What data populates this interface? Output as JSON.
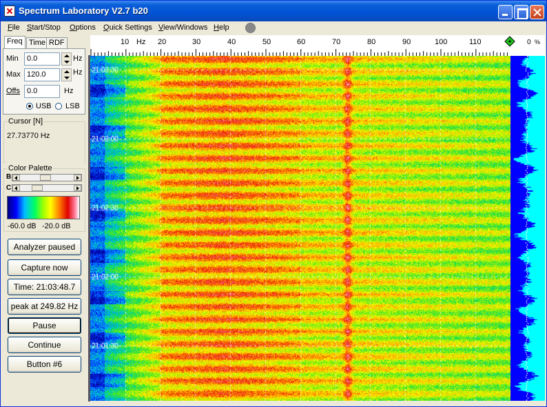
{
  "window": {
    "title": "Spectrum Laboratory V2.7 b20"
  },
  "menu": [
    {
      "label": "File",
      "u": "F",
      "rest": "ile"
    },
    {
      "label": "Start/Stop",
      "u": "S",
      "rest": "tart/Stop"
    },
    {
      "label": "Options",
      "u": "O",
      "rest": "ptions"
    },
    {
      "label": "Quick Settings",
      "u": "Q",
      "rest": "uick Settings"
    },
    {
      "label": "View/Windows",
      "u": "V",
      "rest": "iew/Windows"
    },
    {
      "label": "Help",
      "u": "H",
      "rest": "elp"
    }
  ],
  "tabs": [
    "Freq",
    "Time",
    "RDF"
  ],
  "freq_panel": {
    "min_label": "Min",
    "min_value": "0.0",
    "min_unit": "Hz",
    "max_label": "Max",
    "max_value": "120.0",
    "max_unit": "Hz",
    "offs_label": "Offs",
    "offs_value": "0.0",
    "offs_unit": "Hz",
    "usb_label": "USB",
    "lsb_label": "LSB",
    "sideband": "USB"
  },
  "cursor": {
    "title": "Cursor [N]",
    "value": "27.73770 Hz"
  },
  "palette": {
    "title": "Color Palette",
    "b_label": "B",
    "c_label": "C",
    "low_label": "-60.0 dB",
    "high_label": "-20.0 dB"
  },
  "buttons": {
    "analyzer": "Analyzer paused",
    "capture": "Capture now",
    "time": "Time:  21:03:48.7",
    "peak": "peak at 249.82 Hz",
    "pause": "Pause",
    "continue": "Continue",
    "button6": "Button #6"
  },
  "scale": {
    "labels": [
      "10",
      "Hz",
      "20",
      "30",
      "40",
      "50",
      "60",
      "70",
      "80",
      "90",
      "100",
      "110"
    ],
    "right_value": "0",
    "right_unit": "%"
  },
  "time_markers": [
    "21:03:30",
    "21:03:00",
    "21:02:30",
    "21:02:00",
    "21:01:30"
  ],
  "colors": {
    "titlebar": "#0253d6",
    "accent": "#3a7cf6",
    "spectrum_side": "#00ffff"
  }
}
